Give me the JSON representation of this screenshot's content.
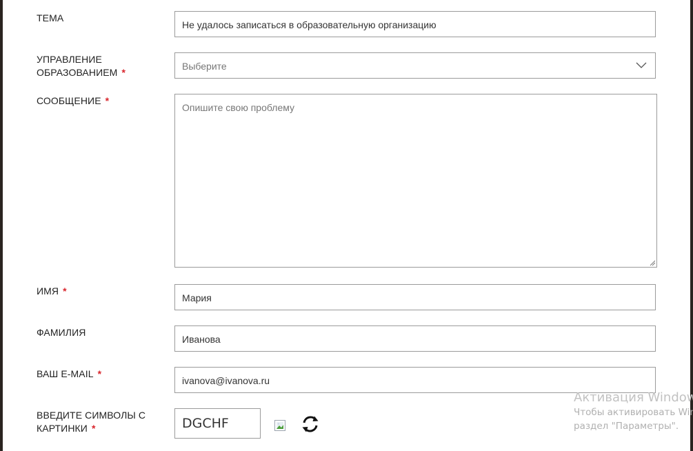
{
  "form": {
    "subject": {
      "label": "ТЕМА",
      "value": "Не удалось записаться в образовательную организацию"
    },
    "education_department": {
      "label_line1": "УПРАВЛЕНИЕ",
      "label_line2": "ОБРАЗОВАНИЕМ",
      "required_mark": "*",
      "selected": "Выберите",
      "icon": "chevron-down-icon"
    },
    "message": {
      "label": "СООБЩЕНИЕ",
      "required_mark": "*",
      "placeholder": "Опишите свою проблему"
    },
    "first_name": {
      "label": "ИМЯ",
      "required_mark": "*",
      "value": "Мария"
    },
    "last_name": {
      "label": "ФАМИЛИЯ",
      "value": "Иванова"
    },
    "email": {
      "label": "ВАШ E-MAIL",
      "required_mark": "*",
      "value": "ivanova@ivanova.ru"
    },
    "captcha": {
      "label_line1": "ВВЕДИТЕ СИМВОЛЫ С",
      "label_line2": "КАРТИНКИ",
      "required_mark": "*",
      "value": "DGCHF",
      "image_icon": "broken-image-icon",
      "refresh_icon": "refresh-icon"
    }
  },
  "watermark": {
    "title": "Активация Windows",
    "line1": "Чтобы активировать Windows, перейдите в",
    "line2": "раздел \"Параметры\"."
  },
  "colors": {
    "required": "#d9262d",
    "border": "#9a9a9a",
    "frame": "#2a2420"
  }
}
